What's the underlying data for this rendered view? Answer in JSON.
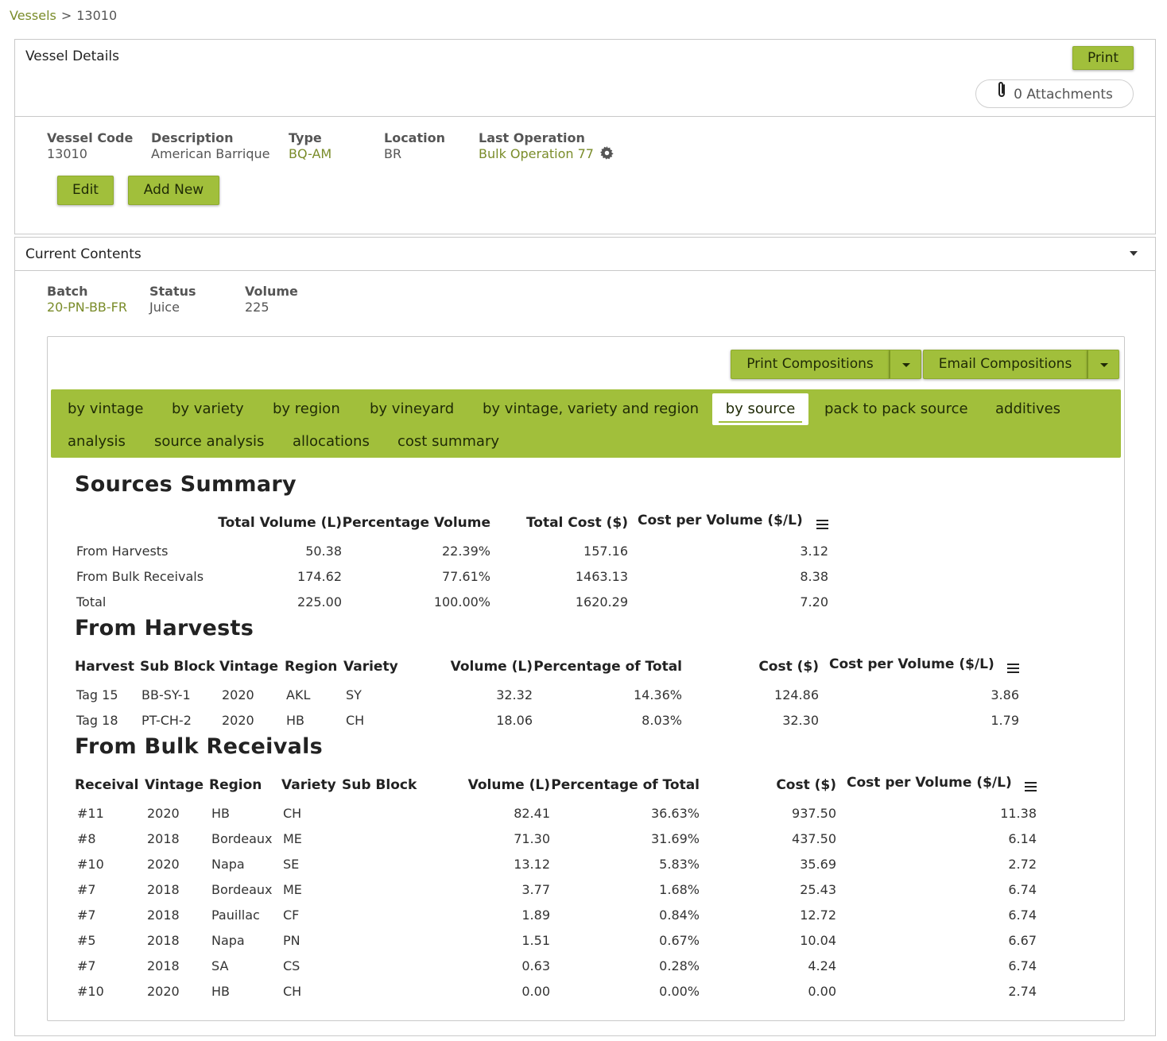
{
  "breadcrumb": {
    "root": "Vessels",
    "separator": ">",
    "current": "13010"
  },
  "vessel_details": {
    "title": "Vessel Details",
    "print_label": "Print",
    "attachments_label": "0 Attachments",
    "fields": {
      "code": {
        "label": "Vessel Code",
        "value": "13010"
      },
      "description": {
        "label": "Description",
        "value": "American Barrique"
      },
      "type": {
        "label": "Type",
        "value": "BQ-AM"
      },
      "location": {
        "label": "Location",
        "value": "BR"
      },
      "last_operation": {
        "label": "Last Operation",
        "value": "Bulk Operation 77"
      }
    },
    "edit_label": "Edit",
    "add_new_label": "Add New"
  },
  "current_contents": {
    "title": "Current Contents",
    "batch": {
      "label": "Batch",
      "value": "20-PN-BB-FR"
    },
    "status": {
      "label": "Status",
      "value": "Juice"
    },
    "volume": {
      "label": "Volume",
      "value": "225"
    },
    "print_compositions_label": "Print Compositions",
    "email_compositions_label": "Email Compositions",
    "tabs": [
      "by vintage",
      "by variety",
      "by region",
      "by vineyard",
      "by vintage, variety and region",
      "by source",
      "pack to pack source",
      "additives",
      "analysis",
      "source analysis",
      "allocations",
      "cost summary"
    ],
    "active_tab": "by source"
  },
  "sources_summary": {
    "title": "Sources Summary",
    "headers": [
      "Total Volume (L)",
      "Percentage Volume",
      "Total Cost ($)",
      "Cost per Volume ($/L)"
    ],
    "rows": [
      [
        "From Harvests",
        "50.38",
        "22.39%",
        "157.16",
        "3.12"
      ],
      [
        "From Bulk Receivals",
        "174.62",
        "77.61%",
        "1463.13",
        "8.38"
      ],
      [
        "Total",
        "225.00",
        "100.00%",
        "1620.29",
        "7.20"
      ]
    ]
  },
  "from_harvests": {
    "title": "From Harvests",
    "headers": [
      "Harvest",
      "Sub Block",
      "Vintage",
      "Region",
      "Variety",
      "Volume (L)",
      "Percentage of Total",
      "Cost ($)",
      "Cost per Volume ($/L)"
    ],
    "rows": [
      [
        "Tag 15",
        "BB-SY-1",
        "2020",
        "AKL",
        "SY",
        "32.32",
        "14.36%",
        "124.86",
        "3.86"
      ],
      [
        "Tag 18",
        "PT-CH-2",
        "2020",
        "HB",
        "CH",
        "18.06",
        "8.03%",
        "32.30",
        "1.79"
      ]
    ]
  },
  "from_bulk_receivals": {
    "title": "From Bulk Receivals",
    "headers": [
      "Receival",
      "Vintage",
      "Region",
      "Variety",
      "Sub Block",
      "Volume (L)",
      "Percentage of Total",
      "Cost ($)",
      "Cost per Volume ($/L)"
    ],
    "rows": [
      [
        "#11",
        "2020",
        "HB",
        "CH",
        "",
        "82.41",
        "36.63%",
        "937.50",
        "11.38"
      ],
      [
        "#8",
        "2018",
        "Bordeaux",
        "ME",
        "",
        "71.30",
        "31.69%",
        "437.50",
        "6.14"
      ],
      [
        "#10",
        "2020",
        "Napa",
        "SE",
        "",
        "13.12",
        "5.83%",
        "35.69",
        "2.72"
      ],
      [
        "#7",
        "2018",
        "Bordeaux",
        "ME",
        "",
        "3.77",
        "1.68%",
        "25.43",
        "6.74"
      ],
      [
        "#7",
        "2018",
        "Pauillac",
        "CF",
        "",
        "1.89",
        "0.84%",
        "12.72",
        "6.74"
      ],
      [
        "#5",
        "2018",
        "Napa",
        "PN",
        "",
        "1.51",
        "0.67%",
        "10.04",
        "6.67"
      ],
      [
        "#7",
        "2018",
        "SA",
        "CS",
        "",
        "0.63",
        "0.28%",
        "4.24",
        "6.74"
      ],
      [
        "#10",
        "2020",
        "HB",
        "CH",
        "",
        "0.00",
        "0.00%",
        "0.00",
        "2.74"
      ]
    ]
  },
  "colors": {
    "accent": "#a1bf3b",
    "link": "#7a8c2a"
  }
}
